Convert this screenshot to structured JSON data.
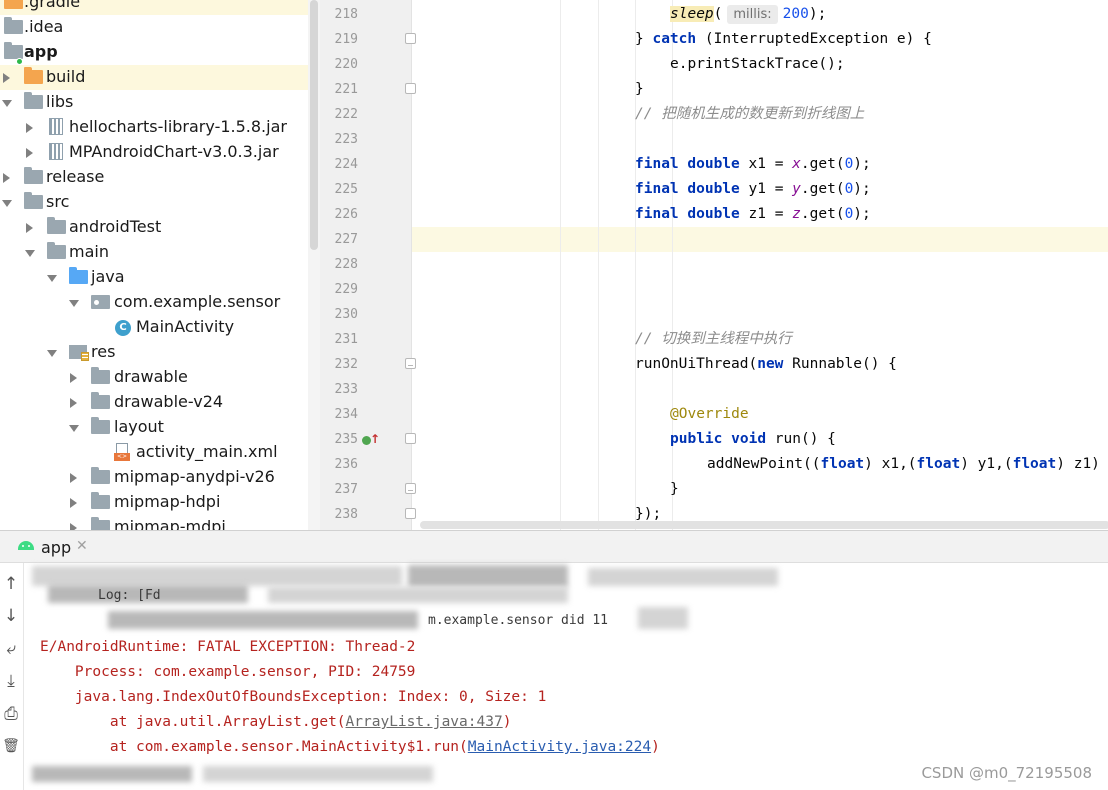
{
  "project_tree": {
    "items": [
      {
        "label": ".gradle",
        "icon": "folder-orange-icon",
        "expanded": null
      },
      {
        "label": ".idea",
        "icon": "folder-icon",
        "expanded": null
      },
      {
        "label": "app",
        "icon": "module-folder-icon",
        "expanded": true
      },
      {
        "label": "build",
        "icon": "folder-orange-icon",
        "expanded": false
      },
      {
        "label": "libs",
        "icon": "folder-icon",
        "expanded": true
      },
      {
        "label": "hellocharts-library-1.5.8.jar",
        "icon": "jar-icon",
        "expanded": false
      },
      {
        "label": "MPAndroidChart-v3.0.3.jar",
        "icon": "jar-icon",
        "expanded": false
      },
      {
        "label": "release",
        "icon": "folder-icon",
        "expanded": false
      },
      {
        "label": "src",
        "icon": "folder-icon",
        "expanded": true
      },
      {
        "label": "androidTest",
        "icon": "folder-icon",
        "expanded": false
      },
      {
        "label": "main",
        "icon": "folder-icon",
        "expanded": true
      },
      {
        "label": "java",
        "icon": "folder-blue-icon",
        "expanded": true
      },
      {
        "label": "com.example.sensor",
        "icon": "package-icon",
        "expanded": true
      },
      {
        "label": "MainActivity",
        "icon": "class-icon",
        "expanded": null
      },
      {
        "label": "res",
        "icon": "resources-folder-icon",
        "expanded": true
      },
      {
        "label": "drawable",
        "icon": "folder-icon",
        "expanded": false
      },
      {
        "label": "drawable-v24",
        "icon": "folder-icon",
        "expanded": false
      },
      {
        "label": "layout",
        "icon": "folder-icon",
        "expanded": true
      },
      {
        "label": "activity_main.xml",
        "icon": "xml-file-icon",
        "expanded": null
      },
      {
        "label": "mipmap-anydpi-v26",
        "icon": "folder-icon",
        "expanded": false
      },
      {
        "label": "mipmap-hdpi",
        "icon": "folder-icon",
        "expanded": false
      },
      {
        "label": "mipmap-mdpi",
        "icon": "folder-icon",
        "expanded": false
      }
    ]
  },
  "editor": {
    "line_numbers": [
      "218",
      "219",
      "220",
      "221",
      "222",
      "223",
      "224",
      "225",
      "226",
      "227",
      "228",
      "229",
      "230",
      "231",
      "232",
      "233",
      "234",
      "235",
      "236",
      "237",
      "238"
    ],
    "current_line": "227",
    "code": {
      "l218_sleep": "sleep",
      "l218_paren": "(",
      "l218_hint": "millis:",
      "l218_num": "200",
      "l218_end": ");",
      "l219_brace": "} ",
      "l219_catch": "catch",
      "l219_rest": " (InterruptedException e) {",
      "l220": "e.printStackTrace();",
      "l221": "}",
      "l222": "// 把随机生成的数更新到折线图上",
      "kw_final": "final",
      "kw_double": "double",
      "l224_var": "x1 = ",
      "l224_field": "x",
      "l225_var": "y1 = ",
      "l225_field": "y",
      "l226_var": "z1 = ",
      "l226_field": "z",
      "get_open": ".get(",
      "zero": "0",
      "get_close": ");",
      "l231": "// 切换到主线程中执行",
      "l232_a": "runOnUiThread(",
      "kw_new": "new",
      "l232_b": " Runnable() {",
      "l234": "@Override",
      "kw_public": "public",
      "kw_void": "void",
      "l235_rest": " run() {",
      "l236_a": "addNewPoint((",
      "kw_float": "float",
      "l236_b": ") x1,(",
      "l236_c": ") y1,(",
      "l236_d": ") z1)",
      "l237": "}",
      "l238": "});"
    }
  },
  "run_panel": {
    "tab_label": "app",
    "tab_close": "✕",
    "toolbar": {
      "up": "↑",
      "down": "↓",
      "wrap": "⤶",
      "scroll_end": "⤓",
      "print": "⎙",
      "trash": "🗑"
    },
    "console": {
      "line1": "E/AndroidRuntime: FATAL EXCEPTION: Thread-2",
      "line2": "    Process: com.example.sensor, PID: 24759",
      "line3": "    java.lang.IndexOutOfBoundsException: Index: 0, Size: 1",
      "line4_prefix": "        at java.util.ArrayList.get(",
      "line4_link": "ArrayList.java:437",
      "line4_suffix": ")",
      "line5_prefix": "        at com.example.sensor.MainActivity$1.run(",
      "line5_link": "MainActivity.java:224",
      "line5_suffix": ")",
      "partial_a": "Log: [Fd",
      "partial_b": "m.example.sensor did 11"
    }
  },
  "watermark": "CSDN @m0_72195508",
  "colors": {
    "keyword": "#0033b3",
    "comment": "#8c8c8c",
    "number": "#1750eb",
    "field": "#871094",
    "annotation": "#9e880d",
    "error_text": "#b5231f",
    "link": "#2a5db0",
    "current_line": "#fcf9e2"
  }
}
